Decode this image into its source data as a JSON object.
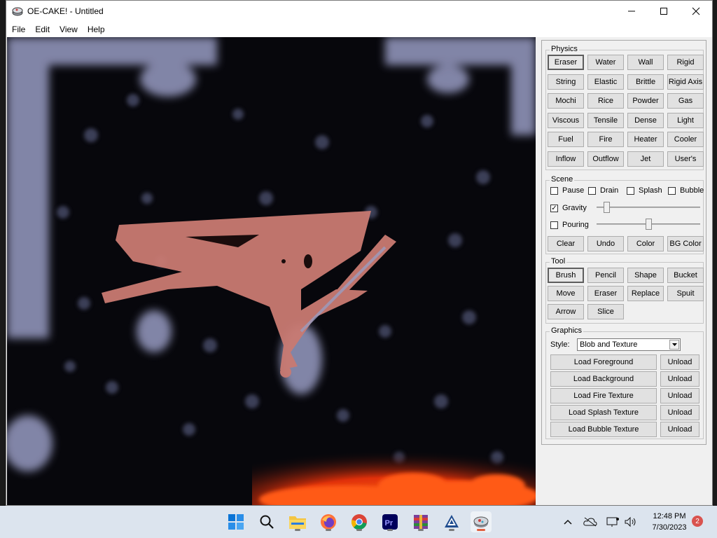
{
  "window": {
    "title": "OE-CAKE! - Untitled"
  },
  "menu": [
    "File",
    "Edit",
    "View",
    "Help"
  ],
  "physics": {
    "label": "Physics",
    "buttons": [
      "Eraser",
      "Water",
      "Wall",
      "Rigid",
      "String",
      "Elastic",
      "Brittle",
      "Rigid Axis",
      "Mochi",
      "Rice",
      "Powder",
      "Gas",
      "Viscous",
      "Tensile",
      "Dense",
      "Light",
      "Fuel",
      "Fire",
      "Heater",
      "Cooler",
      "Inflow",
      "Outflow",
      "Jet",
      "User's"
    ],
    "selected": "Eraser"
  },
  "scene": {
    "label": "Scene",
    "checkboxes": [
      {
        "label": "Pause",
        "checked": false
      },
      {
        "label": "Drain",
        "checked": false
      },
      {
        "label": "Splash",
        "checked": false
      },
      {
        "label": "Bubble",
        "checked": false
      }
    ],
    "gravity": {
      "label": "Gravity",
      "checked": true,
      "level": 0.1
    },
    "pouring": {
      "label": "Pouring",
      "checked": false,
      "level": 0.5
    },
    "buttons": [
      "Clear",
      "Undo",
      "Color",
      "BG Color"
    ]
  },
  "tool": {
    "label": "Tool",
    "buttons": [
      "Brush",
      "Pencil",
      "Shape",
      "Bucket",
      "Move",
      "Eraser",
      "Replace",
      "Spuit",
      "Arrow",
      "Slice"
    ],
    "selected": "Brush"
  },
  "graphics": {
    "label": "Graphics",
    "style_label": "Style:",
    "style_value": "Blob and Texture",
    "load_buttons": [
      "Load Foreground",
      "Load Background",
      "Load Fire Texture",
      "Load Splash Texture",
      "Load Bubble Texture"
    ],
    "unload_label": "Unload"
  },
  "taskbar": {
    "apps": [
      "start-icon",
      "search-icon",
      "file-explorer-icon",
      "firefox-icon",
      "chrome-icon",
      "premiere-pro-icon",
      "winrar-icon",
      "inkscape-icon",
      "oe-cake-icon"
    ],
    "time": "12:48 PM",
    "date": "7/30/2023",
    "notification_count": "2"
  },
  "colors": {
    "accent": "#0078d4",
    "blob": "#c97a72",
    "fire": "#ff4a10"
  }
}
